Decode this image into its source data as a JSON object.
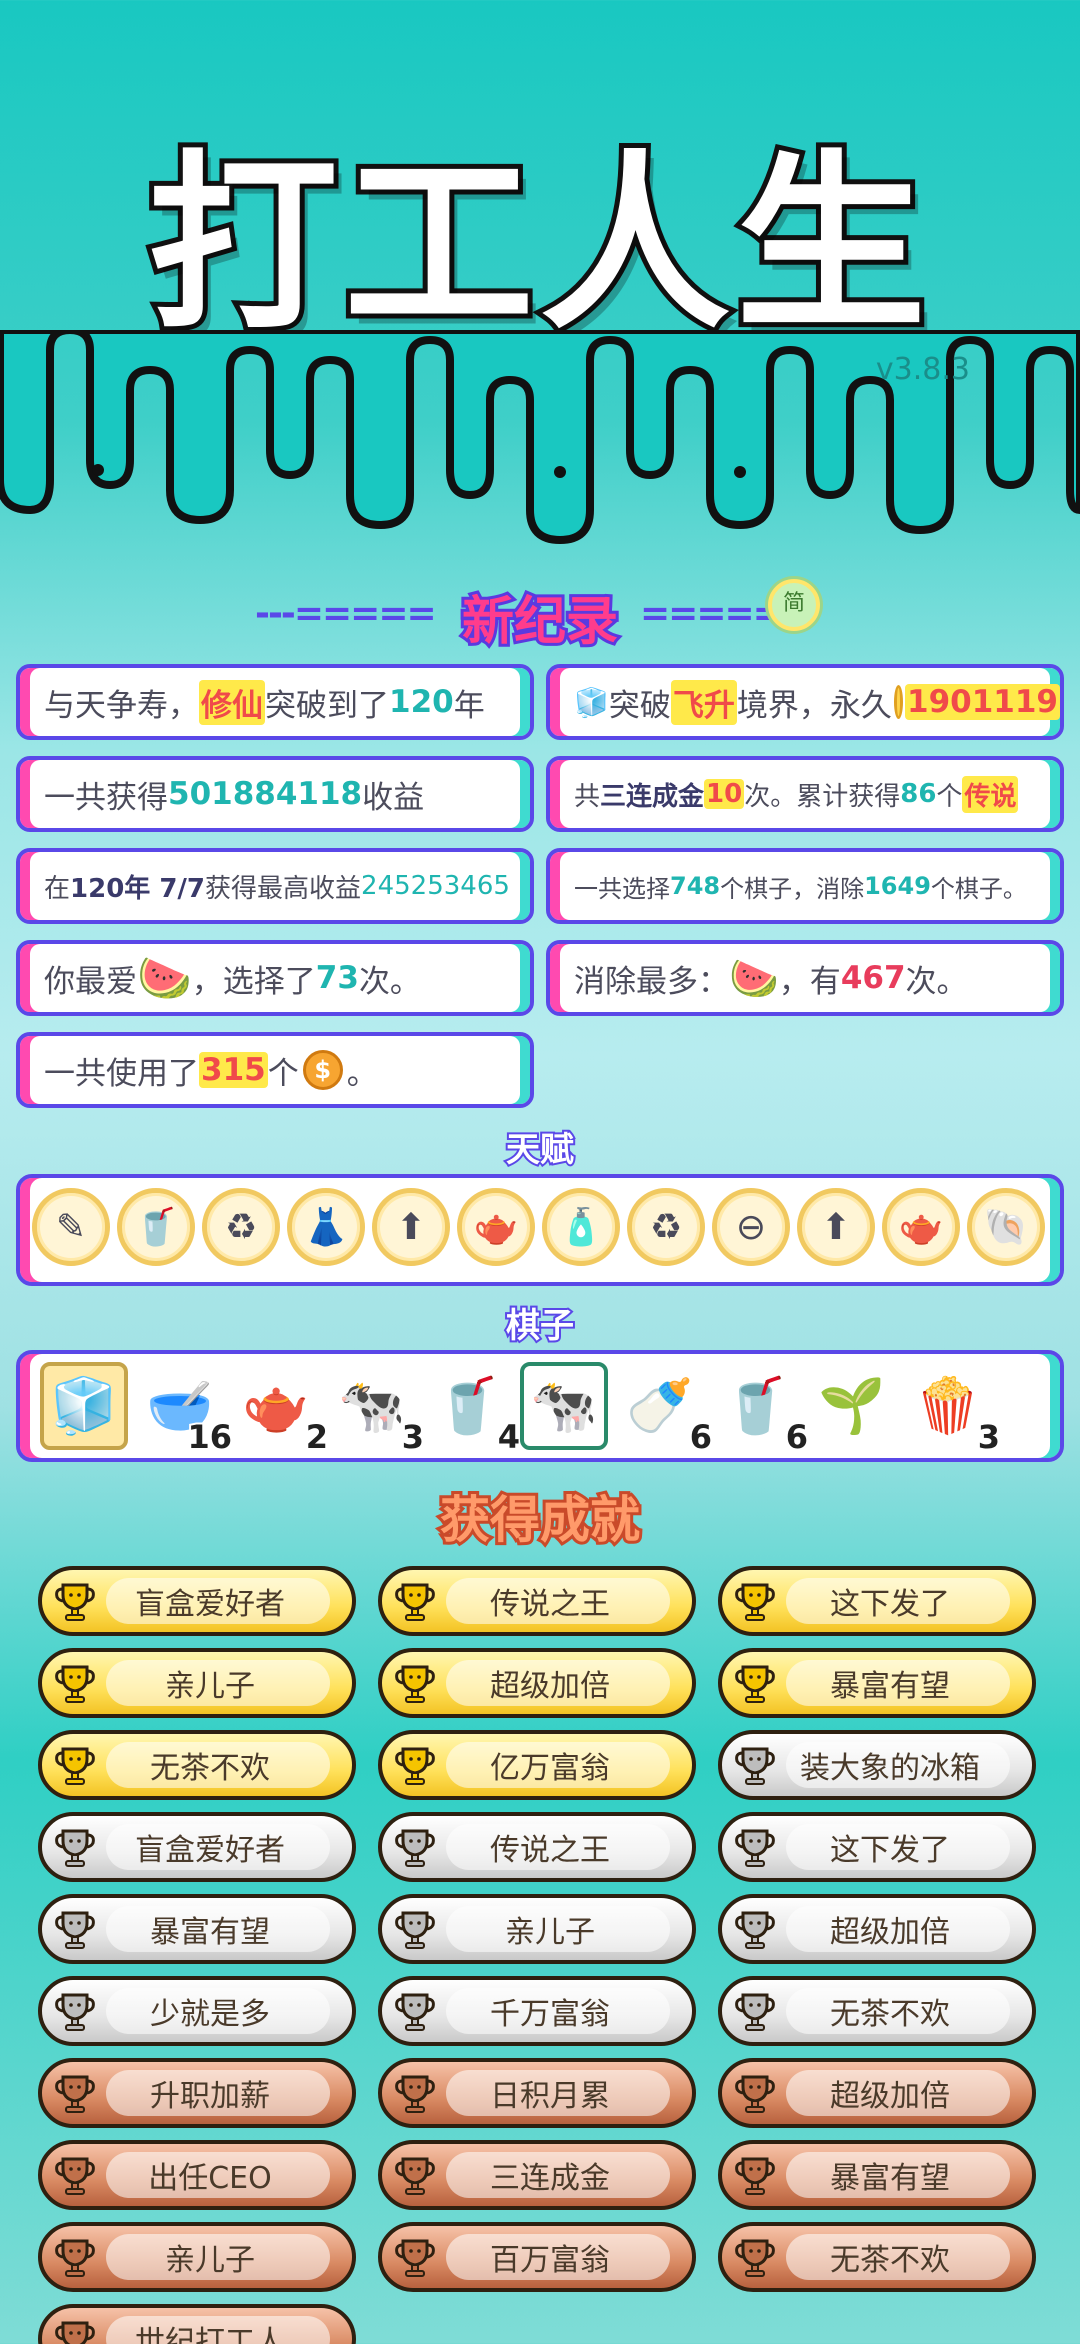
{
  "app": {
    "title": "打工人生",
    "version": "v3.8.3",
    "colors": {
      "accent": "#5a48e8",
      "pink": "#ff4ab0",
      "teal": "#3fdbd0",
      "bg": "#19c8c1"
    }
  },
  "record": {
    "title": "新纪录",
    "left_dashes": "---=====",
    "right_dashes": "=====",
    "lang_button": "简"
  },
  "stats": {
    "s1": {
      "a": "与天争寿，",
      "b": "修仙",
      "c": "突破到了",
      "d": "120",
      "e": "年"
    },
    "s2": {
      "icon": "fridge-icon",
      "a": "突破",
      "b": "飞升",
      "c": "境界，永久",
      "d": "1901119"
    },
    "s3": {
      "a": "一共获得",
      "b": "501884118",
      "c": "收益"
    },
    "s4": {
      "a": "共",
      "b": "三连成金",
      "c": "10",
      "d": "次。累计获得",
      "e": "86",
      "f": "个",
      "g": "传说"
    },
    "s5": {
      "a": "在 ",
      "b": "120年 7/7",
      "c": " 获得最高收益",
      "d": "245253465"
    },
    "s6": {
      "a": "一共选择",
      "b": "748",
      "c": "个棋子，消除",
      "d": "1649",
      "e": "个棋子。"
    },
    "s7": {
      "a": "你最爱",
      "icon": "watermelon-icon",
      "b": "，选择了",
      "c": "73",
      "d": "次。"
    },
    "s8": {
      "a": "消除最多：",
      "icon": "watermelon-slice-icon",
      "b": "，有",
      "c": "467",
      "d": "次。"
    },
    "s9": {
      "a": "一共使用了",
      "b": "315",
      "c": "个",
      "icon": "coin-icon",
      "d": "。"
    }
  },
  "talents": {
    "label": "天赋",
    "items": [
      {
        "icon": "pen-icon",
        "glyph": "✎"
      },
      {
        "icon": "milk-tea-icon",
        "glyph": "🥤"
      },
      {
        "icon": "recycle-icon",
        "glyph": "♻"
      },
      {
        "icon": "skirt-icon",
        "glyph": "👗"
      },
      {
        "icon": "bowl-upgrade-icon",
        "glyph": "⬆"
      },
      {
        "icon": "pitcher-icon",
        "glyph": "🫖"
      },
      {
        "icon": "spray-bottle-icon",
        "glyph": "🧴"
      },
      {
        "icon": "recycle-icon",
        "glyph": "♻"
      },
      {
        "icon": "minus-icon",
        "glyph": "⊖"
      },
      {
        "icon": "bowl-upgrade-icon",
        "glyph": "⬆"
      },
      {
        "icon": "pitcher-icon",
        "glyph": "🫖"
      },
      {
        "icon": "shell-icon",
        "glyph": "🐚"
      }
    ]
  },
  "pieces": {
    "label": "棋子",
    "items": [
      {
        "icon": "fridge-icon",
        "glyph": "🧊",
        "count": ""
      },
      {
        "icon": "bowl-icon",
        "glyph": "🥣",
        "count": "16"
      },
      {
        "icon": "teapot-icon",
        "glyph": "🫖",
        "count": "2"
      },
      {
        "icon": "milk-carton-icon",
        "glyph": "🐄",
        "count": "3"
      },
      {
        "icon": "cup-icon",
        "glyph": "🥤",
        "count": "4"
      },
      {
        "icon": "milk-carton-icon",
        "glyph": "🐄",
        "count": ""
      },
      {
        "icon": "milk-bottle-icon",
        "glyph": "🍼",
        "count": "6"
      },
      {
        "icon": "small-cup-icon",
        "glyph": "🥤",
        "count": "6"
      },
      {
        "icon": "sprout-icon",
        "glyph": "🌱",
        "count": ""
      },
      {
        "icon": "popcorn-bowl-icon",
        "glyph": "🍿",
        "count": "3"
      }
    ]
  },
  "achievements": {
    "title": "获得成就",
    "items": [
      {
        "label": "盲盒爱好者",
        "tier": "gold"
      },
      {
        "label": "传说之王",
        "tier": "gold"
      },
      {
        "label": "这下发了",
        "tier": "gold"
      },
      {
        "label": "亲儿子",
        "tier": "gold"
      },
      {
        "label": "超级加倍",
        "tier": "gold"
      },
      {
        "label": "暴富有望",
        "tier": "gold"
      },
      {
        "label": "无茶不欢",
        "tier": "gold"
      },
      {
        "label": "亿万富翁",
        "tier": "gold"
      },
      {
        "label": "装大象的冰箱",
        "tier": "silver"
      },
      {
        "label": "盲盒爱好者",
        "tier": "silver"
      },
      {
        "label": "传说之王",
        "tier": "silver"
      },
      {
        "label": "这下发了",
        "tier": "silver"
      },
      {
        "label": "暴富有望",
        "tier": "silver"
      },
      {
        "label": "亲儿子",
        "tier": "silver"
      },
      {
        "label": "超级加倍",
        "tier": "silver"
      },
      {
        "label": "少就是多",
        "tier": "silver"
      },
      {
        "label": "千万富翁",
        "tier": "silver"
      },
      {
        "label": "无茶不欢",
        "tier": "silver"
      },
      {
        "label": "升职加薪",
        "tier": "bronze"
      },
      {
        "label": "日积月累",
        "tier": "bronze"
      },
      {
        "label": "超级加倍",
        "tier": "bronze"
      },
      {
        "label": "出任CEO",
        "tier": "bronze"
      },
      {
        "label": "三连成金",
        "tier": "bronze"
      },
      {
        "label": "暴富有望",
        "tier": "bronze"
      },
      {
        "label": "亲儿子",
        "tier": "bronze"
      },
      {
        "label": "百万富翁",
        "tier": "bronze"
      },
      {
        "label": "无茶不欢",
        "tier": "bronze"
      },
      {
        "label": "世纪打工人",
        "tier": "bronze"
      }
    ]
  }
}
